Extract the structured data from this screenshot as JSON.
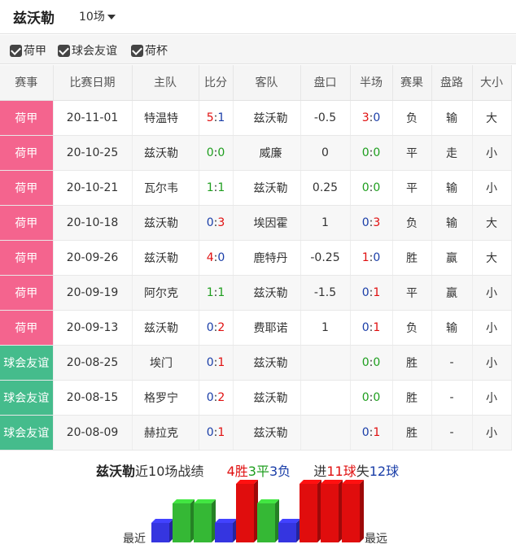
{
  "header": {
    "team_name": "兹沃勒",
    "count_label": "10场"
  },
  "filters": [
    {
      "label": "荷甲",
      "checked": true
    },
    {
      "label": "球会友谊",
      "checked": true
    },
    {
      "label": "荷杯",
      "checked": true
    }
  ],
  "table": {
    "columns": [
      "赛事",
      "比赛日期",
      "主队",
      "比分",
      "客队",
      "盘口",
      "半场",
      "赛果",
      "盘路",
      "大小"
    ],
    "rows": [
      {
        "comp": "荷甲",
        "comp_type": "league",
        "date": "20-11-01",
        "home": "特温特",
        "home_focus": false,
        "score_home": "5",
        "score_away": "1",
        "away": "兹沃勒",
        "away_focus": true,
        "line": "-0.5",
        "half_home": "3",
        "half_away": "0",
        "result": "负",
        "handicap": "输",
        "ou": "大"
      },
      {
        "comp": "荷甲",
        "comp_type": "league",
        "date": "20-10-25",
        "home": "兹沃勒",
        "home_focus": true,
        "score_home": "0",
        "score_away": "0",
        "away": "威廉",
        "away_focus": false,
        "line": "0",
        "half_home": "0",
        "half_away": "0",
        "result": "平",
        "handicap": "走",
        "ou": "小"
      },
      {
        "comp": "荷甲",
        "comp_type": "league",
        "date": "20-10-21",
        "home": "瓦尔韦",
        "home_focus": false,
        "score_home": "1",
        "score_away": "1",
        "away": "兹沃勒",
        "away_focus": true,
        "line": "0.25",
        "half_home": "0",
        "half_away": "0",
        "result": "平",
        "handicap": "输",
        "ou": "小"
      },
      {
        "comp": "荷甲",
        "comp_type": "league",
        "date": "20-10-18",
        "home": "兹沃勒",
        "home_focus": true,
        "score_home": "0",
        "score_away": "3",
        "away": "埃因霍",
        "away_focus": false,
        "line": "1",
        "half_home": "0",
        "half_away": "3",
        "result": "负",
        "handicap": "输",
        "ou": "大"
      },
      {
        "comp": "荷甲",
        "comp_type": "league",
        "date": "20-09-26",
        "home": "兹沃勒",
        "home_focus": true,
        "score_home": "4",
        "score_away": "0",
        "away": "鹿特丹",
        "away_focus": false,
        "line": "-0.25",
        "half_home": "1",
        "half_away": "0",
        "result": "胜",
        "handicap": "赢",
        "ou": "大"
      },
      {
        "comp": "荷甲",
        "comp_type": "league",
        "date": "20-09-19",
        "home": "阿尔克",
        "home_focus": false,
        "score_home": "1",
        "score_away": "1",
        "away": "兹沃勒",
        "away_focus": true,
        "line": "-1.5",
        "half_home": "0",
        "half_away": "1",
        "result": "平",
        "handicap": "赢",
        "ou": "小"
      },
      {
        "comp": "荷甲",
        "comp_type": "league",
        "date": "20-09-13",
        "home": "兹沃勒",
        "home_focus": true,
        "score_home": "0",
        "score_away": "2",
        "away": "费耶诺",
        "away_focus": false,
        "line": "1",
        "half_home": "0",
        "half_away": "1",
        "result": "负",
        "handicap": "输",
        "ou": "小"
      },
      {
        "comp": "球会友谊",
        "comp_type": "friendly",
        "date": "20-08-25",
        "home": "埃门",
        "home_focus": false,
        "score_home": "0",
        "score_away": "1",
        "away": "兹沃勒",
        "away_focus": true,
        "line": "",
        "half_home": "0",
        "half_away": "0",
        "result": "胜",
        "handicap": "-",
        "ou": "小"
      },
      {
        "comp": "球会友谊",
        "comp_type": "friendly",
        "date": "20-08-15",
        "home": "格罗宁",
        "home_focus": false,
        "score_home": "0",
        "score_away": "2",
        "away": "兹沃勒",
        "away_focus": true,
        "line": "",
        "half_home": "0",
        "half_away": "0",
        "result": "胜",
        "handicap": "-",
        "ou": "小"
      },
      {
        "comp": "球会友谊",
        "comp_type": "friendly",
        "date": "20-08-09",
        "home": "赫拉克",
        "home_focus": false,
        "score_home": "0",
        "score_away": "1",
        "away": "兹沃勒",
        "away_focus": true,
        "line": "",
        "half_home": "0",
        "half_away": "1",
        "result": "胜",
        "handicap": "-",
        "ou": "小"
      }
    ]
  },
  "summary": {
    "team": "兹沃勒",
    "recent_text": "近10场战绩",
    "wins": "4胜",
    "draws": "3平",
    "losses": "3负",
    "goals_for_prefix": "进",
    "goals_for": "11球",
    "goals_against_prefix": "失",
    "goals_against": "12球"
  },
  "form_chart": {
    "label_left": "最近",
    "label_right": "最远",
    "results": [
      "负",
      "平",
      "平",
      "负",
      "胜",
      "平",
      "负",
      "胜",
      "胜",
      "胜"
    ],
    "colors": {
      "胜": "#e00d0d",
      "平": "#35b835",
      "负": "#3535e0"
    },
    "levels": {
      "胜": 3,
      "平": 2,
      "负": 1
    }
  },
  "colors": {
    "league": "#f4648e",
    "friendly": "#45bc8c",
    "win": "#e01010",
    "draw": "#1e9e1e",
    "loss": "#1a3ea8",
    "focus_team": "#8b1a1a"
  }
}
